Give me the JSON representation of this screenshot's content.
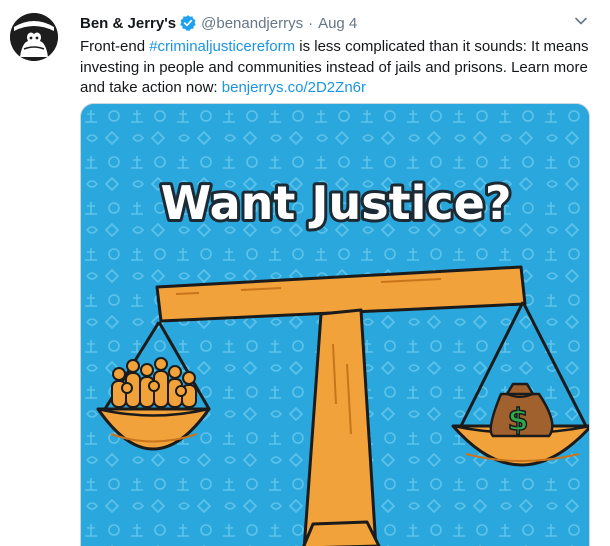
{
  "tweet": {
    "display_name": "Ben & Jerry's",
    "handle": "@benandjerrys",
    "separator": "·",
    "date": "Aug 4",
    "text": {
      "line1_pre": "Front-end ",
      "hashtag": "#criminaljusticereform",
      "line1_post": " is less complicated than it sounds: It means",
      "line2": "investing in people and communities instead of jails and prisons. Learn more",
      "line3_pre": "and take action now: ",
      "link": "benjerrys.co/2D2Zn6r"
    },
    "media": {
      "headline": "Want Justice?",
      "money_symbol": "$"
    }
  },
  "icons": {
    "verified": "verified-badge-icon",
    "caret": "chevron-down-icon",
    "avatar": "ben-and-jerrys-logo"
  },
  "colors": {
    "link": "#1b95e0",
    "secondary_text": "#657786",
    "verified": "#1da1f2",
    "media_background": "#2aa7dd",
    "scale": "#f2a23a"
  }
}
